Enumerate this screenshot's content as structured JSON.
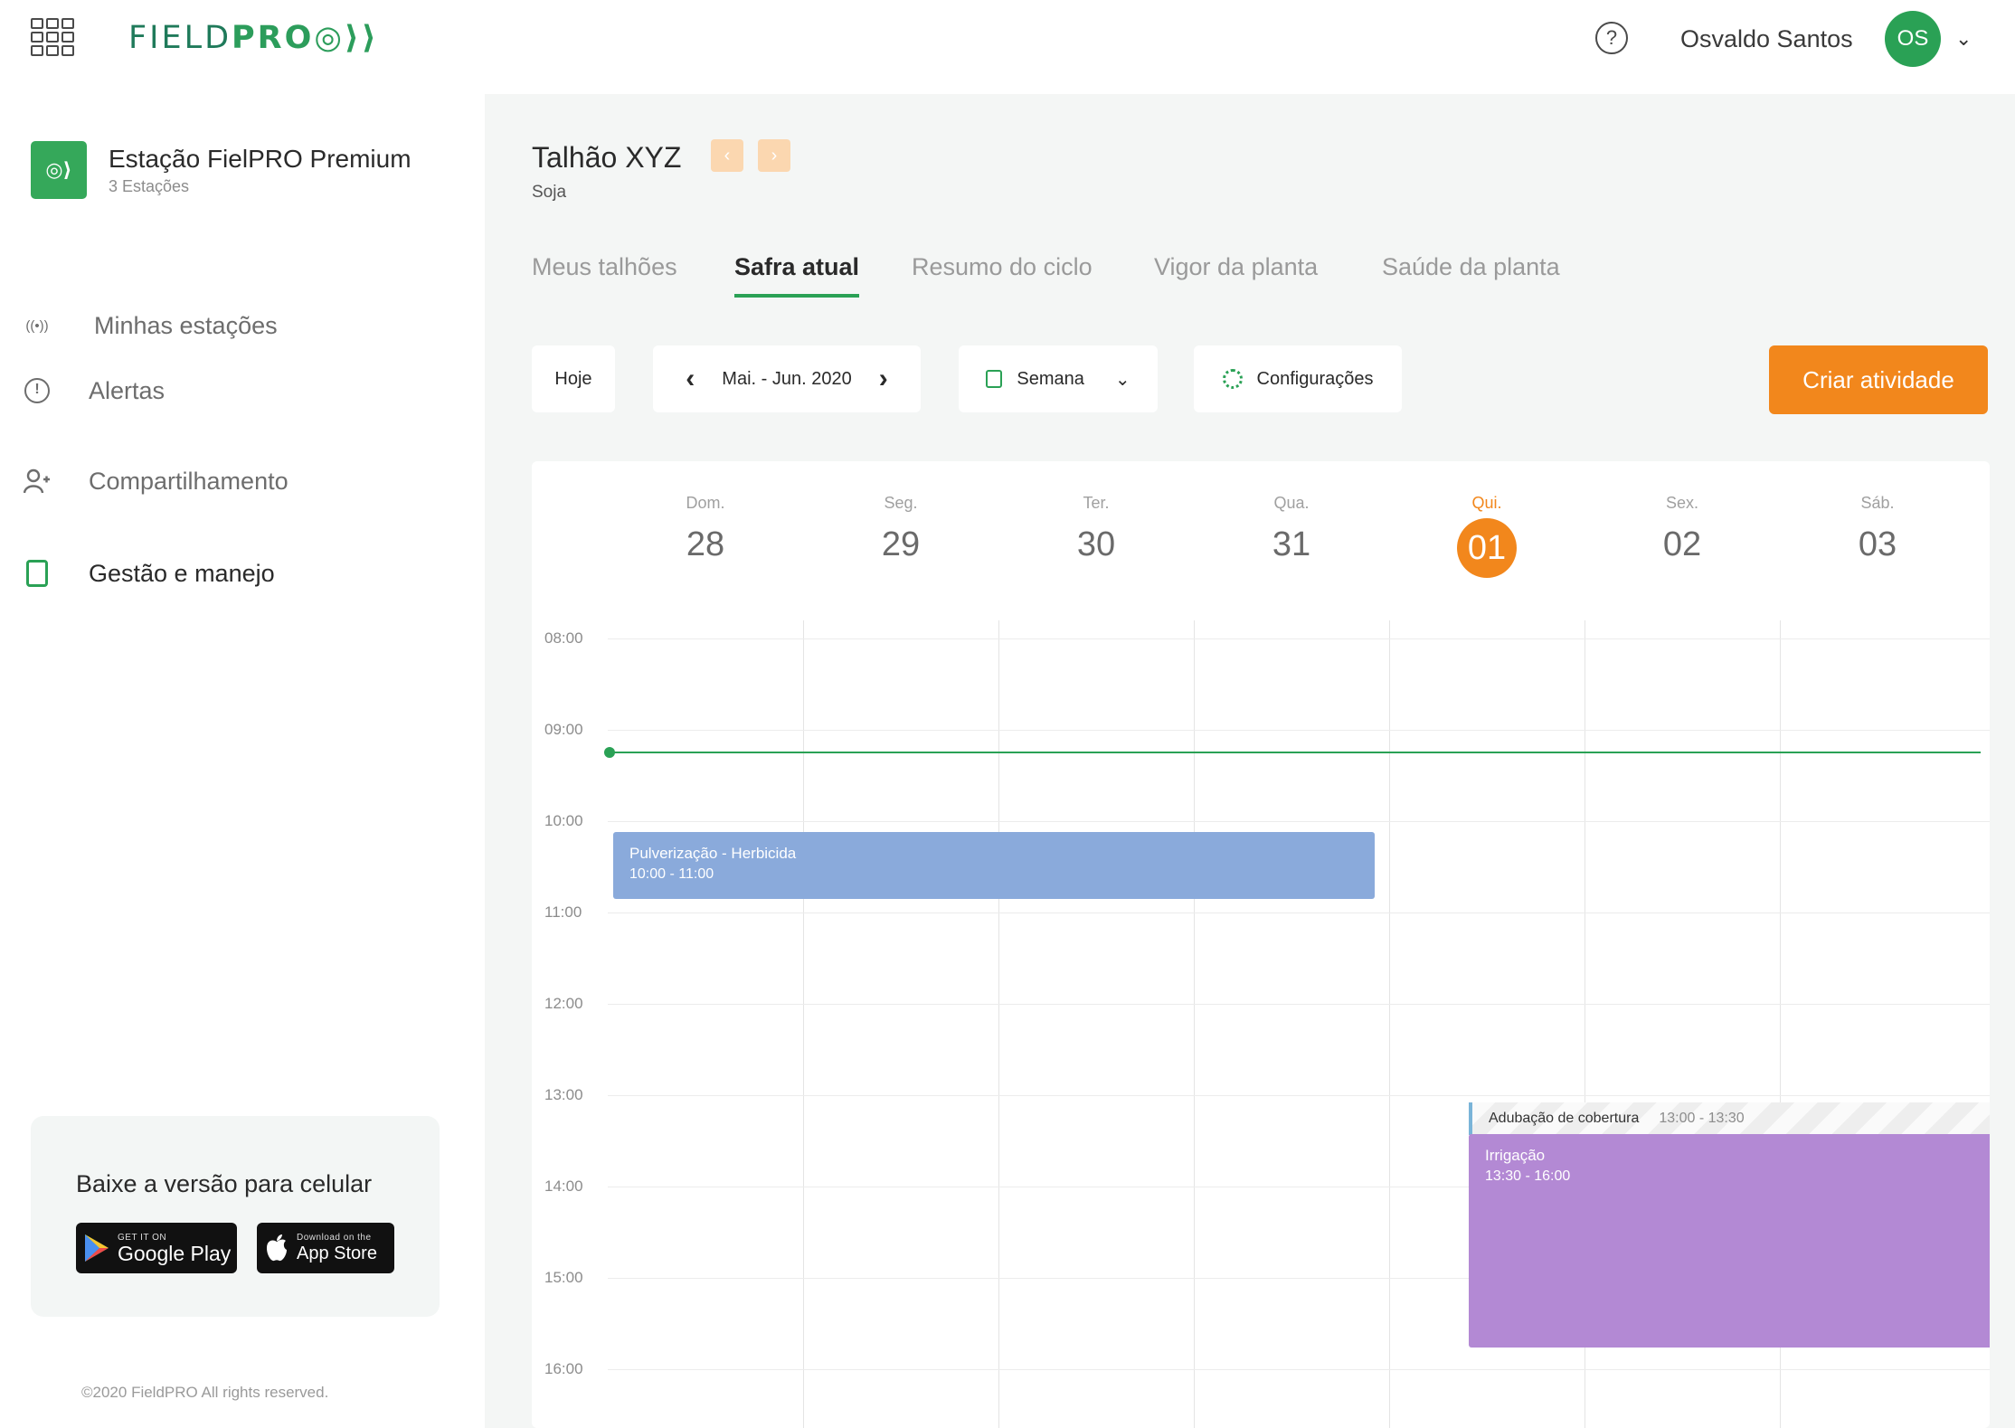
{
  "header": {
    "logo_part1": "FIELD",
    "logo_part2": "PRO",
    "logo_mark": "◎⟩⟩",
    "help_glyph": "?",
    "user_name": "Osvaldo Santos",
    "user_initials": "OS",
    "chevron": "⌄"
  },
  "sidebar": {
    "station": {
      "badge": "◎⟩",
      "name": "Estação FielPRO Premium",
      "subtitle": "3 Estações"
    },
    "items": [
      {
        "label": "Minhas estações",
        "icon": "antenna-icon",
        "glyph": "((•))"
      },
      {
        "label": "Alertas",
        "icon": "alert-icon",
        "glyph": "!"
      },
      {
        "label": "Compartilhamento",
        "icon": "user-share-icon",
        "glyph": "👤"
      },
      {
        "label": "Gestão e manejo",
        "icon": "clipboard-icon",
        "glyph": ""
      }
    ],
    "app_card": {
      "title": "Baixe a versão para celular",
      "google_small": "GET IT ON",
      "google_big": "Google Play",
      "apple_small": "Download on the",
      "apple_big": "App Store"
    },
    "copyright": "©2020 FieldPRO All rights reserved."
  },
  "main": {
    "title": "Talhão XYZ",
    "crop": "Soja",
    "prev_glyph": "‹",
    "next_glyph": "›",
    "tabs": [
      {
        "label": "Meus talhões",
        "active": false
      },
      {
        "label": "Safra atual",
        "active": true
      },
      {
        "label": "Resumo do ciclo",
        "active": false
      },
      {
        "label": "Vigor da planta",
        "active": false
      },
      {
        "label": "Saúde da planta",
        "active": false
      }
    ],
    "toolbar": {
      "today": "Hoje",
      "range": "Mai. - Jun. 2020",
      "prev": "‹",
      "next": "›",
      "view": "Semana",
      "view_chevron": "⌄",
      "settings": "Configurações",
      "create": "Criar atividade"
    }
  },
  "calendar": {
    "days": [
      {
        "name": "Dom.",
        "num": "28",
        "today": false
      },
      {
        "name": "Seg.",
        "num": "29",
        "today": false
      },
      {
        "name": "Ter.",
        "num": "30",
        "today": false
      },
      {
        "name": "Qua.",
        "num": "31",
        "today": false
      },
      {
        "name": "Qui.",
        "num": "01",
        "today": true
      },
      {
        "name": "Sex.",
        "num": "02",
        "today": false
      },
      {
        "name": "Sáb.",
        "num": "03",
        "today": false
      }
    ],
    "hours": [
      "08:00",
      "09:00",
      "10:00",
      "11:00",
      "12:00",
      "13:00",
      "14:00",
      "15:00",
      "16:00"
    ],
    "now_time": "09:15",
    "events": [
      {
        "title": "Pulverização - Herbicida",
        "time": "10:00 - 11:00",
        "color": "#8aaadb"
      },
      {
        "title": "Adubação de cobertura",
        "time": "13:00 - 13:30",
        "color": "#7ab4d8"
      },
      {
        "title": "Irrigação",
        "time": "13:30 - 16:00",
        "color": "#b389d4"
      }
    ]
  },
  "colors": {
    "brand_green": "#2aa155",
    "accent_orange": "#f2871c",
    "event_blue": "#8aaadb",
    "event_purple": "#b389d4"
  }
}
